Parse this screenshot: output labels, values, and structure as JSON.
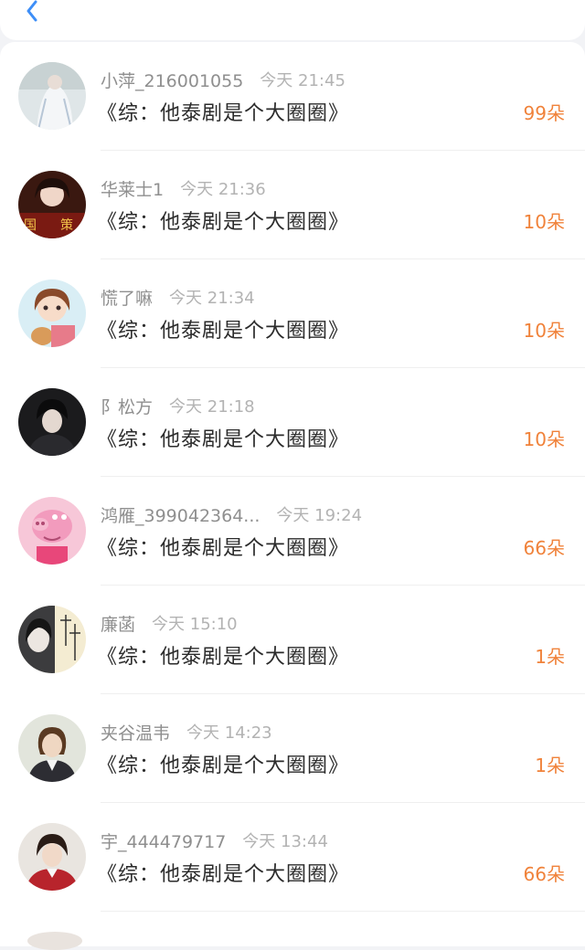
{
  "header": {
    "back_icon": "chevron-left-icon",
    "accent": "#3d8ef7"
  },
  "rows": [
    {
      "name": "小萍_216001055",
      "time": "今天 21:45",
      "title": "《综：他泰剧是个大圈圈》",
      "amount": "99朵"
    },
    {
      "name": "华莱士1",
      "time": "今天 21:36",
      "title": "《综：他泰剧是个大圈圈》",
      "amount": "10朵"
    },
    {
      "name": "慌了嘛",
      "time": "今天 21:34",
      "title": "《综：他泰剧是个大圈圈》",
      "amount": "10朵"
    },
    {
      "name": "阝松方",
      "time": "今天 21:18",
      "title": "《综：他泰剧是个大圈圈》",
      "amount": "10朵"
    },
    {
      "name": "鸿雁_399042364...",
      "time": "今天 19:24",
      "title": "《综：他泰剧是个大圈圈》",
      "amount": "66朵"
    },
    {
      "name": "廉菡",
      "time": "今天 15:10",
      "title": "《综：他泰剧是个大圈圈》",
      "amount": "1朵"
    },
    {
      "name": "夹谷温韦",
      "time": "今天 14:23",
      "title": "《综：他泰剧是个大圈圈》",
      "amount": "1朵"
    },
    {
      "name": "宇_444479717",
      "time": "今天 13:44",
      "title": "《综：他泰剧是个大圈圈》",
      "amount": "66朵"
    }
  ],
  "colors": {
    "amount": "#f0823a",
    "name": "#8f8f8f",
    "time": "#b3b3b3",
    "title": "#2b2b2b"
  }
}
